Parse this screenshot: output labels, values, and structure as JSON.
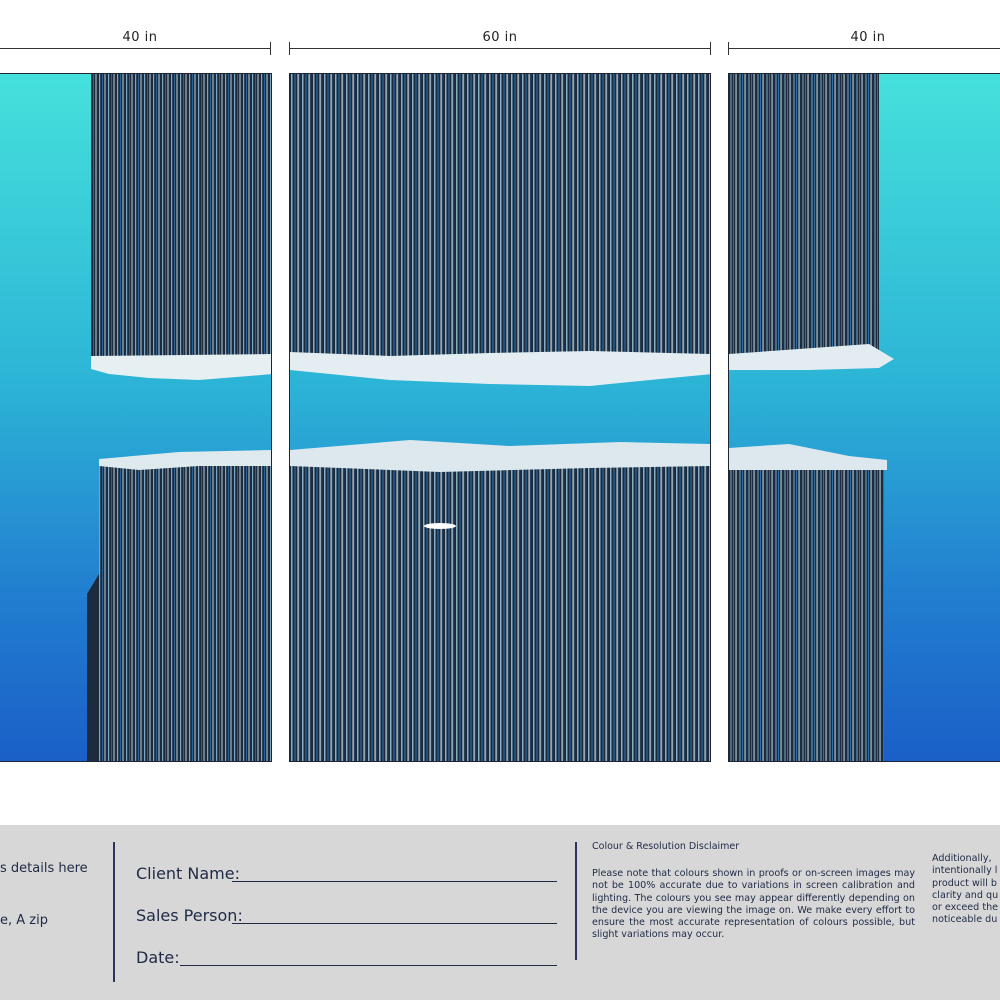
{
  "dimensions": {
    "left": "40 in",
    "center": "60 in",
    "right": "40 in"
  },
  "artwork": {
    "description_icon": "crystal-photo",
    "colors": {
      "sky_top": "#45e1dc",
      "sky_bottom": "#1a5fc7",
      "crystal_dark": "#1b2a3c",
      "crystal_light": "#dce9ee"
    }
  },
  "footer": {
    "contact_line_1": "s details here",
    "contact_line_2": "e, A zip",
    "client_label": "Client Name:",
    "sales_label": "Sales Person:",
    "date_label": "Date:",
    "disclaimer_title": "Colour & Resolution Disclaimer",
    "disclaimer_body": "Please note that colours shown in proofs or on-screen images may not be 100% accurate due to variations in screen calibration and lighting. The colours you see may appear differently depending on the device you are viewing the image on. We make every effort to ensure the most accurate representation of colours possible, but slight variations may occur.",
    "disclaimer2_lines": [
      "Additionally,",
      "intentionally l",
      "product will b",
      "clarity and qu",
      "or exceed the",
      "noticeable du"
    ]
  }
}
